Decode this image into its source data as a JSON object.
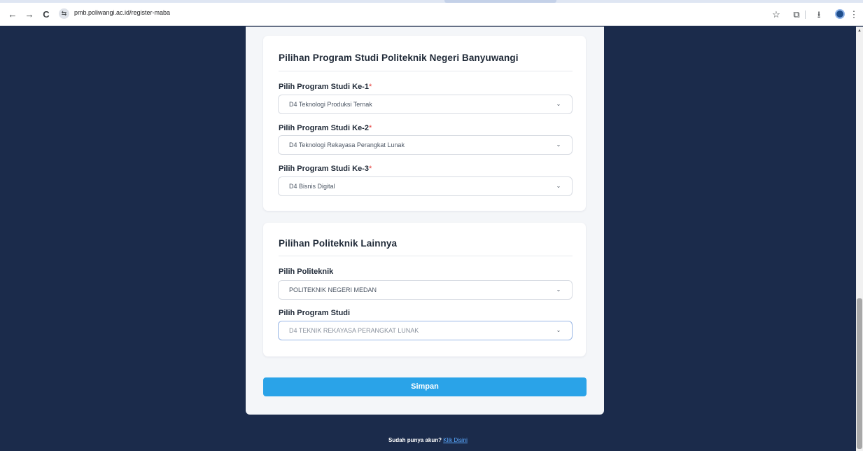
{
  "browser": {
    "url": "pmb.poliwangi.ac.id/register-maba",
    "icons": [
      "back-arrow-icon",
      "forward-arrow-icon",
      "reload-icon",
      "site-info-icon",
      "bookmark-star-icon",
      "extensions-icon",
      "download-icon",
      "profile-avatar",
      "menu-dots-icon"
    ],
    "glyphs": {
      "back": "←",
      "forward": "→",
      "reload": "C",
      "site": "⇆",
      "star": "☆",
      "ext": "⧉",
      "download": "⭳",
      "menu": "⋮"
    }
  },
  "section_programs": {
    "title": "Pilihan Program Studi Politeknik Negeri Banyuwangi",
    "fields": [
      {
        "label": "Pilih Program Studi Ke-1",
        "required_mark": "*",
        "value": "D4 Teknologi Produksi Ternak"
      },
      {
        "label": "Pilih Program Studi Ke-2",
        "required_mark": "*",
        "value": "D4 Teknologi Rekayasa Perangkat Lunak"
      },
      {
        "label": "Pilih Program Studi Ke-3",
        "required_mark": "*",
        "value": "D4 Bisnis Digital"
      }
    ]
  },
  "section_other": {
    "title": "Pilihan Politeknik Lainnya",
    "polytechnic_label": "Pilih Politeknik",
    "polytechnic_value": "POLITEKNIK NEGERI MEDAN",
    "program_label": "Pilih Program Studi",
    "program_value": "D4 TEKNIK REKAYASA PERANGKAT LUNAK"
  },
  "chevron": "⌄",
  "submit_label": "Simpan",
  "footer": {
    "text": "Sudah punya akun?",
    "link": "Klik Disini"
  },
  "colors": {
    "page_background": "#1b2b4b",
    "primary_button": "#2aa3e8",
    "required": "#e53935",
    "link": "#5aa9ff"
  }
}
